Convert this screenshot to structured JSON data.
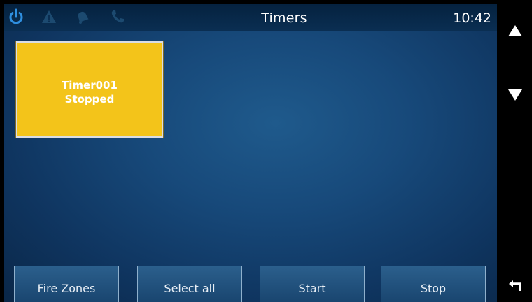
{
  "header": {
    "title": "Timers",
    "clock": "10:42",
    "status_icons": [
      "power-icon",
      "warning-icon",
      "bell-icon",
      "phone-icon"
    ]
  },
  "timers": [
    {
      "name": "Timer001",
      "state": "Stopped"
    }
  ],
  "softkeys": {
    "fire_zones": "Fire Zones",
    "select_all": "Select all",
    "start": "Start",
    "stop": "Stop"
  },
  "nav": {
    "scroll_up_icon": "up-triangle-icon",
    "scroll_down_icon": "down-triangle-icon",
    "back_icon": "return-arrow-icon"
  },
  "colors": {
    "background": "#17497a",
    "header": "#05223f",
    "timer_tile": "#f3c41a",
    "power_active": "#2f8fe0",
    "dim_icon": "#1c4a70"
  }
}
